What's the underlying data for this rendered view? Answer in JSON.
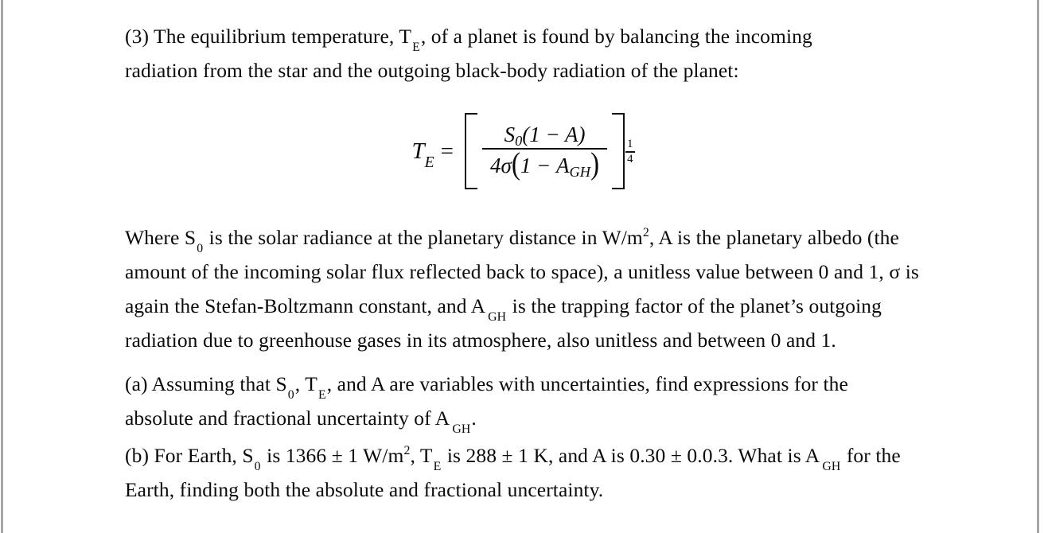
{
  "document": {
    "problem_number": "(3)",
    "intro": {
      "text_part_1": "(3) The equilibrium temperature, T",
      "sub_1": "E",
      "text_part_2": ", of a planet is found by balancing the incoming radiation from the star and the outgoing black-body radiation of the planet:"
    },
    "equation": {
      "lhs_symbol": "T",
      "lhs_subscript": "E",
      "equals": "=",
      "numerator_symbol": "S",
      "numerator_subscript": "0",
      "numerator_rest": "(1 − A)",
      "denominator_lead": "4σ",
      "denominator_paren_open": "(",
      "denominator_inner": "1 − A",
      "denominator_inner_subscript": "GH",
      "denominator_paren_close": ")",
      "exponent_numerator": "1",
      "exponent_denominator": "4",
      "plain_text": "T_E = [ S_0(1 - A) / ( 4σ(1 - A_GH) ) ]^(1/4)"
    },
    "where_paragraph": {
      "seg_1": "Where S",
      "sub_1": "0",
      "seg_2": " is the solar radiance at the planetary distance in W/m",
      "sup_1": "2",
      "seg_3": ", A is the planetary albedo (the amount of the incoming solar flux reflected back to space), a unitless value between 0 and 1, σ is again the Stefan-Boltzmann constant, and A",
      "sub_2": "GH",
      "seg_4": " is the trapping factor of the planet’s outgoing radiation due to greenhouse gases in its atmosphere, also unitless and between 0 and 1."
    },
    "part_a": {
      "seg_1": "(a) Assuming that S",
      "sub_1": "0",
      "seg_2": ", T",
      "sub_2": "E",
      "seg_3": ", and A are variables with uncertainties, find expressions for the absolute and fractional uncertainty of A",
      "sub_3": "GH",
      "seg_4": "."
    },
    "part_b": {
      "seg_1": "(b) For Earth, S",
      "sub_1": "0",
      "seg_2": " is 1366 ± 1 W/m",
      "sup_1": "2",
      "seg_3": ", T",
      "sub_2": "E",
      "seg_4": " is 288 ± 1 K, and A is 0.30 ± 0.0.3. What is A",
      "sub_3": "GH",
      "seg_5": " for the Earth, finding both the absolute and fractional uncertainty."
    },
    "values": {
      "solar_constant": "1366",
      "solar_constant_uncertainty": "1",
      "solar_constant_units": "W/m2",
      "equilibrium_temperature": "288",
      "equilibrium_temperature_uncertainty": "1",
      "equilibrium_temperature_units": "K",
      "albedo": "0.30",
      "albedo_uncertainty": "0.0.3"
    },
    "colors": {
      "background": "#ffffff",
      "text": "#0a0a0a",
      "edge_rule": "#a6a6a6"
    }
  }
}
